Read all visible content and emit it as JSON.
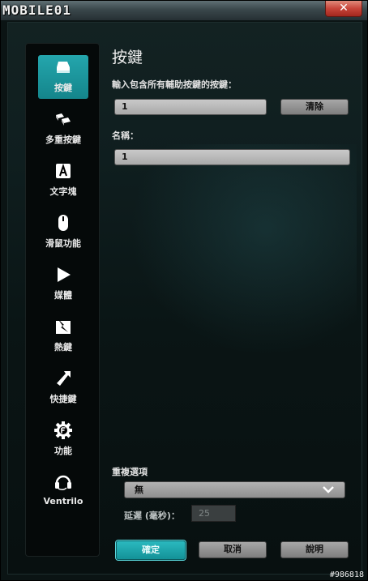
{
  "window": {
    "watermark": "MOBILE01",
    "close_label": "✕"
  },
  "sidebar": {
    "items": [
      {
        "label": "按鍵",
        "icon": "key-icon",
        "active": true
      },
      {
        "label": "多重按鍵",
        "icon": "multi-key-icon",
        "active": false
      },
      {
        "label": "文字塊",
        "icon": "text-block-icon",
        "active": false
      },
      {
        "label": "滑鼠功能",
        "icon": "mouse-icon",
        "active": false
      },
      {
        "label": "媒體",
        "icon": "play-icon",
        "active": false
      },
      {
        "label": "熱鍵",
        "icon": "hotkey-icon",
        "active": false
      },
      {
        "label": "快捷鍵",
        "icon": "shortcut-arrow-icon",
        "active": false
      },
      {
        "label": "功能",
        "icon": "function-gear-icon",
        "active": false
      },
      {
        "label": "Ventrilo",
        "icon": "headset-icon",
        "active": false
      }
    ]
  },
  "main": {
    "title": "按鍵",
    "key_prompt": "輸入包含所有輔助按鍵的按鍵：",
    "key_value": "1",
    "clear_label": "清除",
    "name_label": "名稱：",
    "name_value": "1"
  },
  "repeat": {
    "title": "重複選項",
    "selected": "無",
    "delay_label": "延遲 (毫秒)：",
    "delay_value": "25"
  },
  "footer": {
    "ok_label": "確定",
    "cancel_label": "取消",
    "help_label": "說明"
  },
  "corner_id": "#986818",
  "colors": {
    "accent": "#1a9aa0",
    "close": "#c8453a"
  }
}
